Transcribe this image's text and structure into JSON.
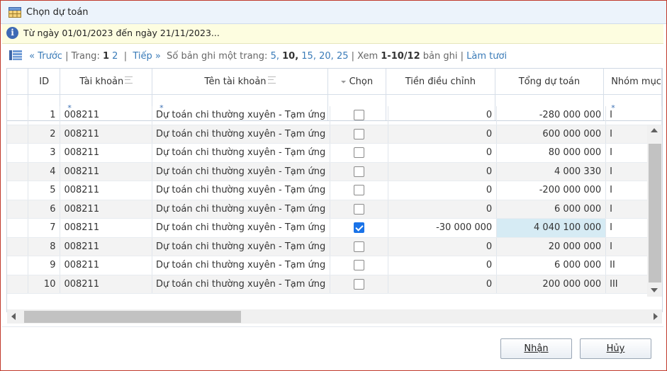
{
  "window": {
    "title": "Chọn dự toán"
  },
  "info": {
    "text": "Từ ngày 01/01/2023 đến ngày 21/11/2023..."
  },
  "pager": {
    "prev": "« Trước",
    "page_label": "| Trang:",
    "current_page": "1",
    "other_page": "2",
    "sep1": "|",
    "next": "Tiếp »",
    "per_page_label": "Số bản ghi một trang:",
    "size_5": "5,",
    "size_10": "10,",
    "size_15": "15,",
    "size_20": "20,",
    "size_25": "25",
    "sep2": "| Xem",
    "range": "1-10/12",
    "range_suffix": "bản ghi",
    "sep3": "|",
    "refresh": "Làm tươi"
  },
  "columns": {
    "id": "ID",
    "account": "Tài khoản",
    "account_name": "Tên tài khoản",
    "select": "Chọn",
    "adjustment": "Tiền điều chỉnh",
    "total": "Tổng dự toán",
    "group": "Nhóm mục"
  },
  "filters": {
    "account": "*",
    "account_name": "*",
    "group": "*"
  },
  "rows": [
    {
      "id": "1",
      "account": "008211",
      "name": "Dự toán chi thường xuyên - Tạm ứng",
      "checked": false,
      "adjustment": "0",
      "total": "-280 000 000",
      "group": "I"
    },
    {
      "id": "2",
      "account": "008211",
      "name": "Dự toán chi thường xuyên - Tạm ứng",
      "checked": false,
      "adjustment": "0",
      "total": "600 000 000",
      "group": "I"
    },
    {
      "id": "3",
      "account": "008211",
      "name": "Dự toán chi thường xuyên - Tạm ứng",
      "checked": false,
      "adjustment": "0",
      "total": "80 000 000",
      "group": "I"
    },
    {
      "id": "4",
      "account": "008211",
      "name": "Dự toán chi thường xuyên - Tạm ứng",
      "checked": false,
      "adjustment": "0",
      "total": "4 000 330",
      "group": "I"
    },
    {
      "id": "5",
      "account": "008211",
      "name": "Dự toán chi thường xuyên - Tạm ứng",
      "checked": false,
      "adjustment": "0",
      "total": "-200 000 000",
      "group": "I"
    },
    {
      "id": "6",
      "account": "008211",
      "name": "Dự toán chi thường xuyên - Tạm ứng",
      "checked": false,
      "adjustment": "0",
      "total": "6 000 000",
      "group": "I"
    },
    {
      "id": "7",
      "account": "008211",
      "name": "Dự toán chi thường xuyên - Tạm ứng",
      "checked": true,
      "adjustment": "-30 000 000",
      "total": "4 040 100 000",
      "group": "I"
    },
    {
      "id": "8",
      "account": "008211",
      "name": "Dự toán chi thường xuyên - Tạm ứng",
      "checked": false,
      "adjustment": "0",
      "total": "20 000 000",
      "group": "I"
    },
    {
      "id": "9",
      "account": "008211",
      "name": "Dự toán chi thường xuyên - Tạm ứng",
      "checked": false,
      "adjustment": "0",
      "total": "6 000 000",
      "group": "II"
    },
    {
      "id": "10",
      "account": "008211",
      "name": "Dự toán chi thường xuyên - Tạm ứng",
      "checked": false,
      "adjustment": "0",
      "total": "200 000 000",
      "group": "III"
    }
  ],
  "buttons": {
    "ok": "Nhận",
    "cancel": "Hủy"
  },
  "colors": {
    "link": "#3a7bb8",
    "highlight": "#d6ebf4",
    "check": "#1a73e8",
    "border": "#c0392b"
  }
}
